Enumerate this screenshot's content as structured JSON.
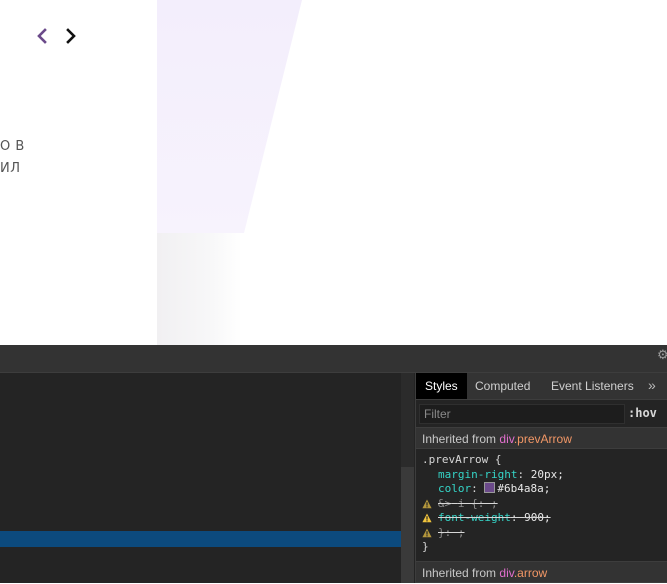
{
  "page": {
    "prev_arrow": "‹",
    "next_arrow": "›",
    "text_line_1": "О В",
    "text_line_2": "ИЛ"
  },
  "devtools": {
    "tabs": [
      "Styles",
      "Computed",
      "Event Listeners"
    ],
    "more_tabs": "»",
    "filter_placeholder": "Filter",
    "hov_label": ":hov",
    "inherited_label": "Inherited from",
    "inherited_1_tag": "div",
    "inherited_1_class": ".prevArrow",
    "inherited_2_tag": "div",
    "inherited_2_class": ".arrow",
    "rule": {
      "selector": ".prevArrow",
      "open_brace": "{",
      "close_brace": "}",
      "declarations": [
        {
          "prop": "margin-right",
          "value": "20px;"
        },
        {
          "prop": "color",
          "value": "#6b4a8a;"
        },
        {
          "prop": "&>",
          "value": "i {: ;"
        },
        {
          "prop": "font-weight",
          "value": "900;"
        },
        {
          "prop": "}",
          "value": ": ;"
        }
      ]
    },
    "colors": {
      "swatch": "#6b4a8a",
      "arrow_prev": "#6b4a8a",
      "arrow_next": "#111111"
    }
  }
}
